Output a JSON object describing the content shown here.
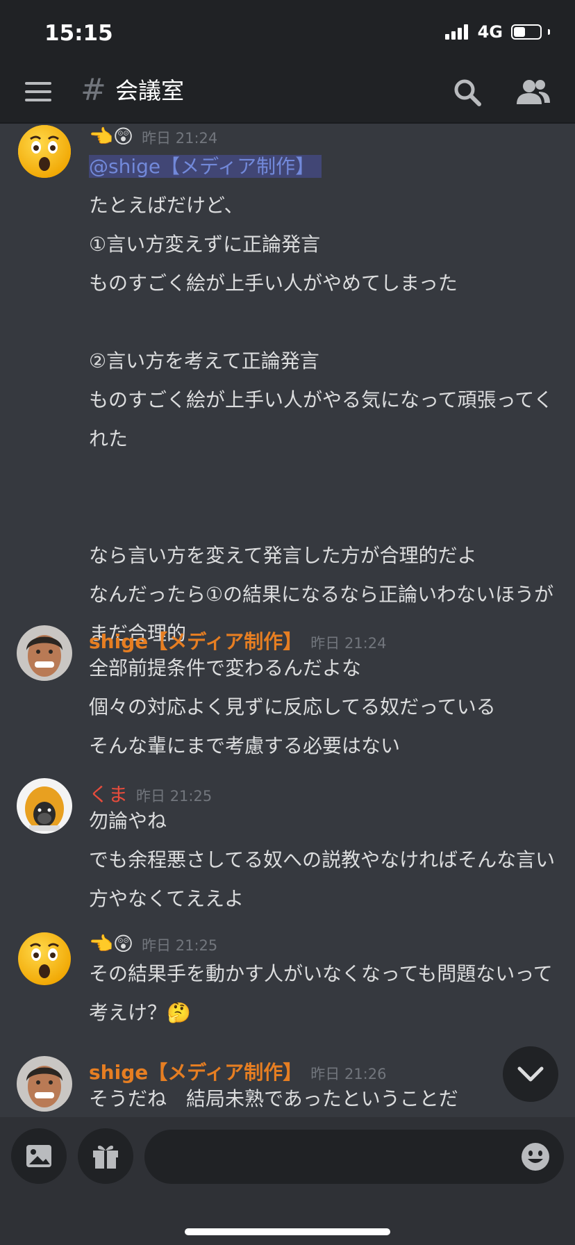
{
  "status_bar": {
    "time": "15:15",
    "network": "4G",
    "battery_level": 0.45
  },
  "header": {
    "hash": "#",
    "channel_name": "会議室"
  },
  "messages": [
    {
      "avatar": "astonished-face-emoji",
      "username": "👈😲",
      "username_color": "#dcddde",
      "timestamp": "昨日 21:24",
      "mention": "@shige【メディア制作】",
      "text": "たとえばだけど、\n①言い方変えずに正論発言\nものすごく絵が上手い人がやめてしまった\n\n②言い方を考えて正論発言\nものすごく絵が上手い人がやる気になって頑張ってくれた\n\n\nなら言い方を変えて発言した方が合理的だよ\nなんだったら①の結果になるなら正論いわないほうがまだ合理的"
    },
    {
      "avatar": "shige-avatar",
      "username": "shige【メディア制作】",
      "username_color": "#e67e22",
      "timestamp": "昨日 21:24",
      "text": "全部前提条件で変わるんだよな\n個々の対応よく見ずに反応してる奴だっている\nそんな輩にまで考慮する必要はない"
    },
    {
      "avatar": "kuma-avatar",
      "username": "くま",
      "username_color": "#e74c3c",
      "timestamp": "昨日 21:25",
      "text": "勿論やね\nでも余程悪さしてる奴への説教やなければそんな言い方やなくてええよ"
    },
    {
      "avatar": "astonished-face-emoji",
      "username": "👈😲",
      "username_color": "#dcddde",
      "timestamp": "昨日 21:25",
      "text": "その結果手を動かす人がいなくなっても問題ないって考えけ？🤔"
    },
    {
      "avatar": "shige-avatar",
      "username": "shige【メディア制作】",
      "username_color": "#e67e22",
      "timestamp": "昨日 21:26",
      "text": "そうだね　結局未熟であったということだ"
    }
  ],
  "composer": {
    "placeholder": ""
  },
  "icons": {
    "menu": "hamburger-icon",
    "search": "search-icon",
    "members": "members-icon",
    "scroll_down": "chevron-down-icon",
    "image": "image-icon",
    "gift": "gift-icon",
    "emoji": "emoji-icon"
  },
  "colors": {
    "background": "#36393f",
    "header": "#202225",
    "mention_bg": "#414675",
    "mention_text": "#7289da"
  }
}
